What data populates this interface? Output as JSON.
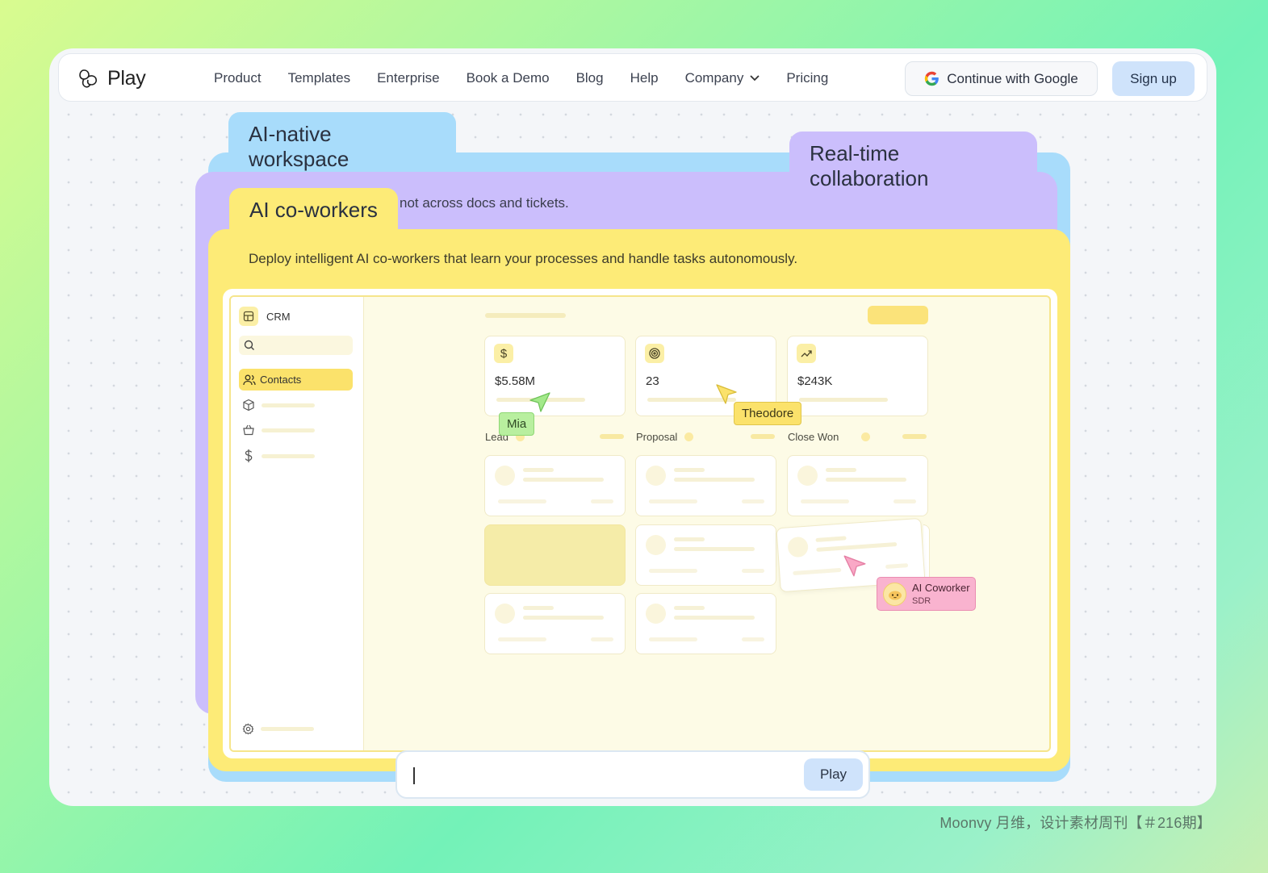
{
  "brand": {
    "name": "Play",
    "logo_icon": "play-logo-icon"
  },
  "nav": {
    "links": [
      "Product",
      "Templates",
      "Enterprise",
      "Book a Demo",
      "Blog",
      "Help",
      "Company",
      "Pricing"
    ],
    "google_label": "Continue with Google",
    "signup_label": "Sign up"
  },
  "folders": {
    "blue_title": "AI-native workspace",
    "purple_title": "Real-time collaboration",
    "purple_subtitle": "not across docs and tickets.",
    "yellow_title": "AI co-workers",
    "yellow_subtitle": "Deploy intelligent AI co-workers that learn your processes and handle tasks autonomously."
  },
  "crm": {
    "title": "CRM",
    "contacts_label": "Contacts",
    "stats": [
      {
        "icon": "dollar-icon",
        "value": "$5.58M"
      },
      {
        "icon": "target-icon",
        "value": "23"
      },
      {
        "icon": "trend-up-icon",
        "value": "$243K"
      }
    ],
    "columns": [
      "Lead",
      "Proposal",
      "Close Won"
    ]
  },
  "cursors": {
    "mia": "Mia",
    "theodore": "Theodore",
    "coworker_name": "AI Coworker",
    "coworker_role": "SDR"
  },
  "chat": {
    "play_label": "Play"
  },
  "credit": "Moonvy 月维，设计素材周刊【＃216期】",
  "colors": {
    "blue": "#a8dcfb",
    "purple": "#cbbefc",
    "yellow": "#fdeb77",
    "pink": "#f9b3cf",
    "green": "#b8ef9f"
  }
}
